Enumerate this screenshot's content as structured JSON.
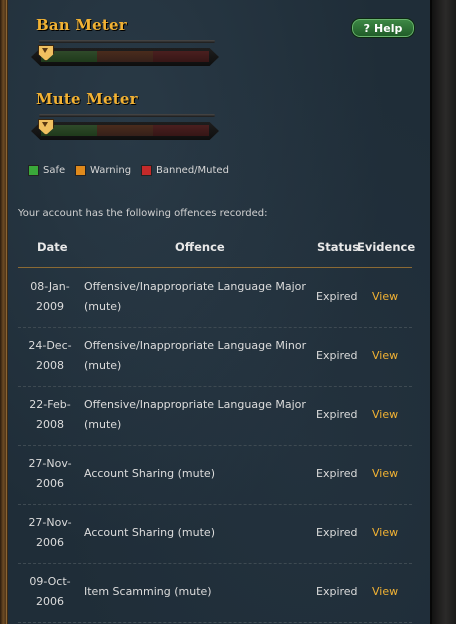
{
  "ban_meter": {
    "title": "Ban Meter",
    "level": 0
  },
  "mute_meter": {
    "title": "Mute Meter",
    "level": 0
  },
  "help_button": {
    "label": "Help",
    "icon": "?"
  },
  "legend": [
    {
      "label": "Safe",
      "color": "#3aa83a"
    },
    {
      "label": "Warning",
      "color": "#e08a1c"
    },
    {
      "label": "Banned/Muted",
      "color": "#c42a2a"
    }
  ],
  "intro_text": "Your account has the following offences recorded:",
  "table": {
    "headers": {
      "date": "Date",
      "offence": "Offence",
      "status": "Status",
      "evidence": "Evidence"
    },
    "rows": [
      {
        "date_line1": "08-Jan-",
        "date_line2": "2009",
        "offence_line1": "Offensive/Inappropriate Language Major",
        "offence_line2": "(mute)",
        "status": "Expired",
        "evidence": "View"
      },
      {
        "date_line1": "24-Dec-",
        "date_line2": "2008",
        "offence_line1": "Offensive/Inappropriate Language Minor",
        "offence_line2": "(mute)",
        "status": "Expired",
        "evidence": "View"
      },
      {
        "date_line1": "22-Feb-",
        "date_line2": "2008",
        "offence_line1": "Offensive/Inappropriate Language Major",
        "offence_line2": "(mute)",
        "status": "Expired",
        "evidence": "View"
      },
      {
        "date_line1": "27-Nov-",
        "date_line2": "2006",
        "offence_line1": "Account Sharing (mute)",
        "offence_line2": "",
        "status": "Expired",
        "evidence": "View"
      },
      {
        "date_line1": "27-Nov-",
        "date_line2": "2006",
        "offence_line1": "Account Sharing (mute)",
        "offence_line2": "",
        "status": "Expired",
        "evidence": "View"
      },
      {
        "date_line1": "09-Oct-",
        "date_line2": "2006",
        "offence_line1": "Item Scamming (mute)",
        "offence_line2": "",
        "status": "Expired",
        "evidence": "View"
      }
    ]
  }
}
